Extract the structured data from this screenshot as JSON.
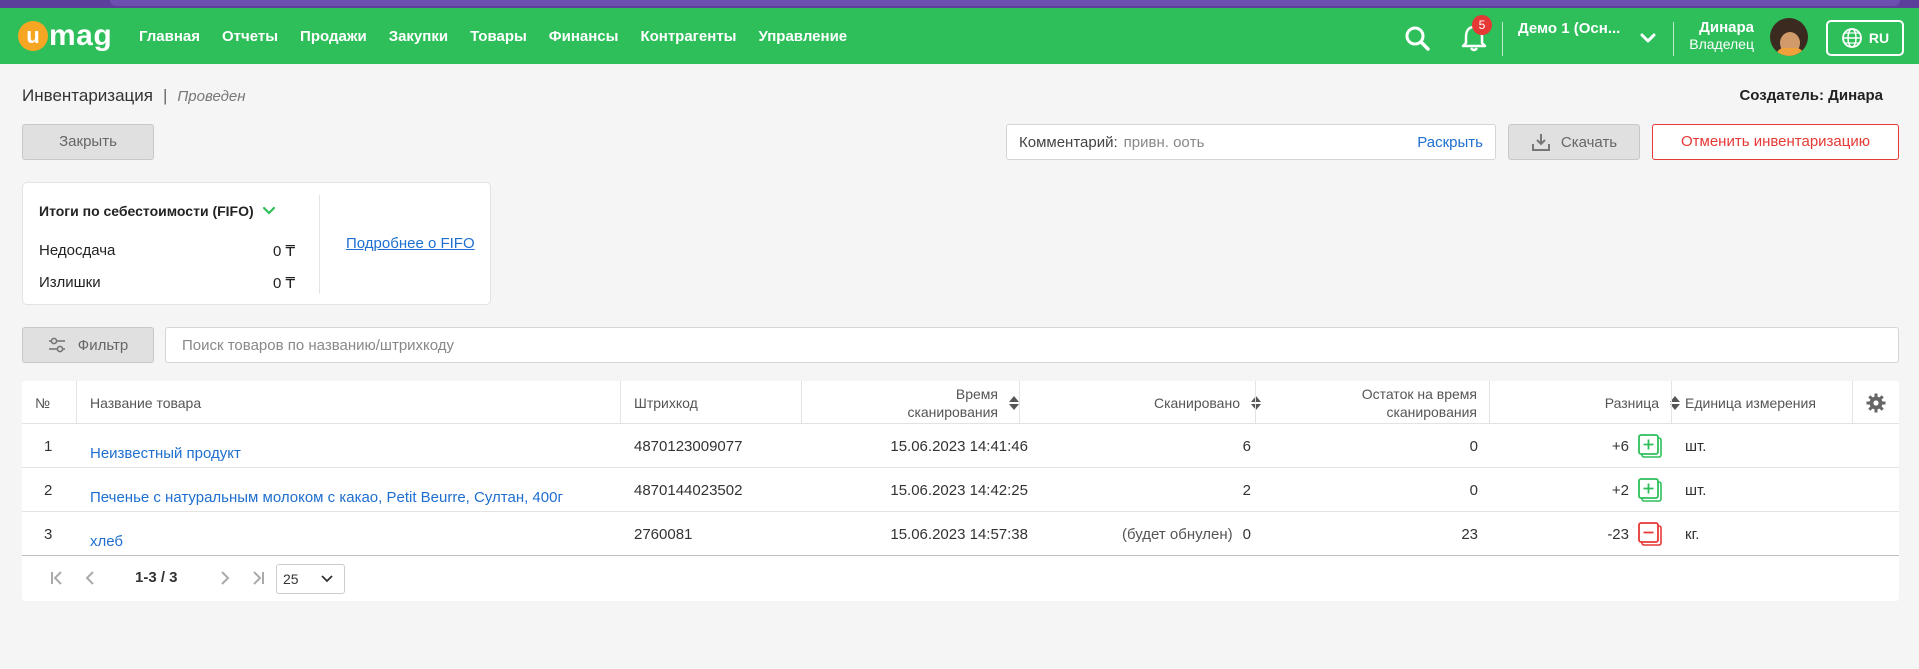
{
  "brand": {
    "logo_letter": "u",
    "logo_rest": "mag"
  },
  "nav": {
    "menu": [
      "Главная",
      "Отчеты",
      "Продажи",
      "Закупки",
      "Товары",
      "Финансы",
      "Контрагенты",
      "Управление"
    ],
    "notifications_count": "5",
    "store": "Демо 1 (Осн...",
    "user_name": "Динара",
    "user_role": "Владелец",
    "language": "RU"
  },
  "header": {
    "title": "Инвентаризация",
    "separator": "|",
    "status": "Проведен",
    "creator": "Создатель: Динара"
  },
  "actions": {
    "close_label": "Закрыть",
    "comment_label": "Комментарий:",
    "comment_value": "привн. оoть",
    "comment_expand": "Раскрыть",
    "download_label": "Скачать",
    "cancel_label": "Отменить инвентаризацию"
  },
  "fifo": {
    "title": "Итоги по себестоимости (FIFO)",
    "shortage_label": "Недосдача",
    "shortage_value": "0 ₸",
    "surplus_label": "Излишки",
    "surplus_value": "0 ₸",
    "more_link": "Подробнее о FIFO"
  },
  "filter": {
    "button_label": "Фильтр",
    "search_placeholder": "Поиск товаров по названию/штрихкоду"
  },
  "table": {
    "columns": {
      "num": "№",
      "name": "Название товара",
      "barcode": "Штрихкод",
      "scan_time_1": "Время",
      "scan_time_2": "сканирования",
      "scanned": "Сканировано",
      "stock_1": "Остаток на время",
      "stock_2": "сканирования",
      "diff": "Разница",
      "unit": "Единица измерения"
    },
    "rows": [
      {
        "num": "1",
        "name": "Неизвестный продукт",
        "barcode": "4870123009077",
        "time": "15.06.2023 14:41:46",
        "scanned_note": "",
        "scanned": "6",
        "stock": "0",
        "diff": "+6",
        "diff_type": "plus",
        "unit": "шт."
      },
      {
        "num": "2",
        "name": "Печенье с натуральным молоком с какао, Petit Beurre, Султан, 400г",
        "barcode": "4870144023502",
        "time": "15.06.2023 14:42:25",
        "scanned_note": "",
        "scanned": "2",
        "stock": "0",
        "diff": "+2",
        "diff_type": "plus",
        "unit": "шт."
      },
      {
        "num": "3",
        "name": "хлеб",
        "barcode": "2760081",
        "time": "15.06.2023 14:57:38",
        "scanned_note": "(будет обнулен)",
        "scanned": "0",
        "stock": "23",
        "diff": "-23",
        "diff_type": "minus",
        "unit": "кг."
      }
    ]
  },
  "pagination": {
    "range": "1-3 / 3",
    "page_size": "25"
  },
  "colors": {
    "nav_green": "#2ebf5b",
    "accent_blue": "#1e6fcf",
    "danger_red": "#e53935",
    "purple_strip": "#5b3f9a"
  }
}
